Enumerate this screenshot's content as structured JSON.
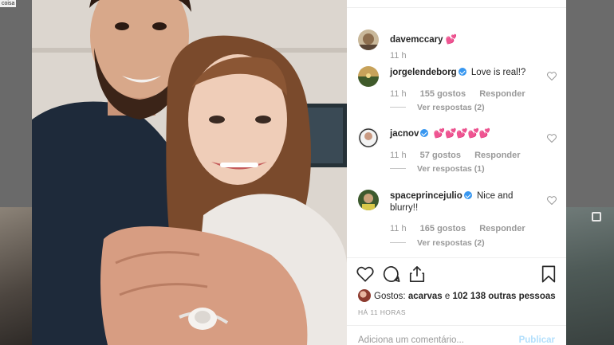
{
  "tooltip": "coisa",
  "comments": [
    {
      "user": "davemccary",
      "verified": false,
      "text": "💕",
      "time": "11 h"
    },
    {
      "user": "jorgelendeborg",
      "verified": true,
      "text": "Love is real!?",
      "time": "11 h",
      "likes": "155 gostos",
      "reply": "Responder",
      "view_replies": "Ver respostas (2)"
    },
    {
      "user": "jacnov",
      "verified": true,
      "text": "💕💕💕💕💕",
      "time": "11 h",
      "likes": "57 gostos",
      "reply": "Responder",
      "view_replies": "Ver respostas (1)"
    },
    {
      "user": "spaceprincejulio",
      "verified": true,
      "text": "Nice and blurry!!",
      "time": "11 h",
      "likes": "165 gostos",
      "reply": "Responder",
      "view_replies": "Ver respostas (2)"
    }
  ],
  "actions": {
    "like_icon": "heart-outline-icon",
    "comment_icon": "speech-bubble-icon",
    "share_icon": "share-icon",
    "save_icon": "bookmark-icon"
  },
  "likes_summary": {
    "prefix": "Gostos:",
    "user": "acarvas",
    "joiner": "e",
    "others": "102 138 outras pessoas"
  },
  "time_ago": "HÁ 11 HORAS",
  "comment_box": {
    "placeholder": "Adiciona um comentário...",
    "publish": "Publicar"
  },
  "colors": {
    "accent_blue": "#3897f0",
    "publish_disabled": "#b2dffc",
    "muted_text": "#999999"
  }
}
